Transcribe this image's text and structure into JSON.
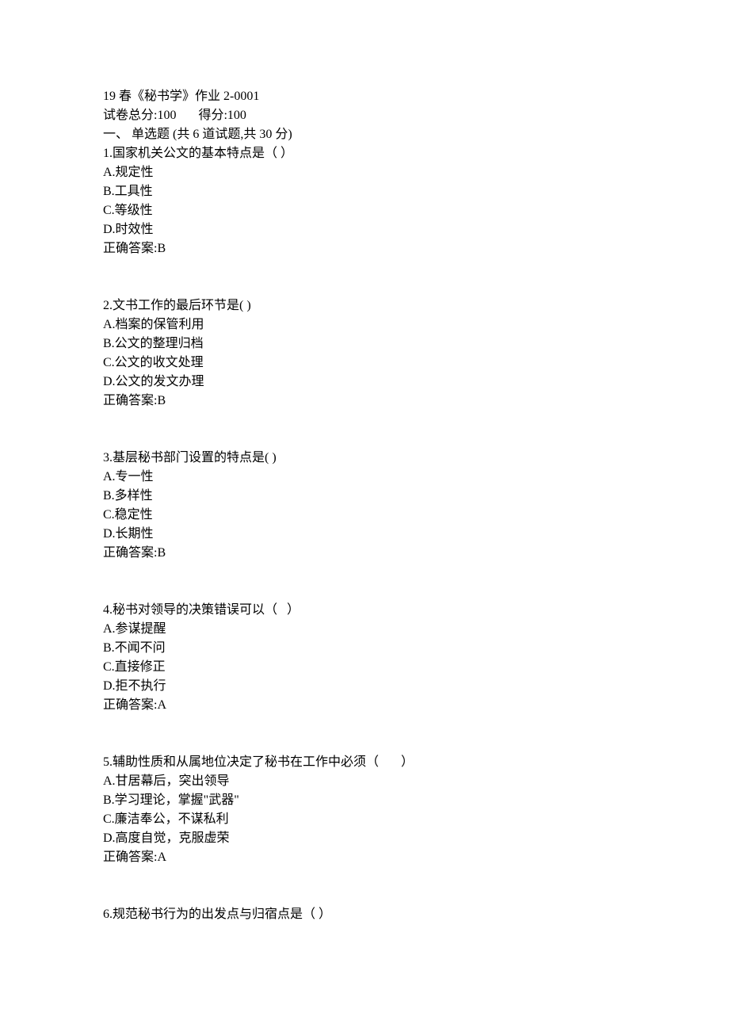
{
  "header": {
    "title": "19 春《秘书学》作业 2-0001",
    "total_score_label": "试卷总分:100",
    "earned_score_label": "得分:100",
    "section_header": "一、 单选题 (共 6 道试题,共 30 分)"
  },
  "questions": [
    {
      "stem": "1.国家机关公文的基本特点是（ ）",
      "options": [
        "A.规定性",
        "B.工具性",
        "C.等级性",
        "D.时效性"
      ],
      "answer": "正确答案:B"
    },
    {
      "stem": "2.文书工作的最后环节是( )",
      "options": [
        "A.档案的保管利用",
        "B.公文的整理归档",
        "C.公文的收文处理",
        "D.公文的发文办理"
      ],
      "answer": "正确答案:B"
    },
    {
      "stem": "3.基层秘书部门设置的特点是( )",
      "options": [
        "A.专一性",
        "B.多样性",
        "C.稳定性",
        "D.长期性"
      ],
      "answer": "正确答案:B"
    },
    {
      "stem": "4.秘书对领导的决策错误可以（   ）",
      "options": [
        "A.参谋提醒",
        "B.不闻不问",
        "C.直接修正",
        "D.拒不执行"
      ],
      "answer": "正确答案:A"
    },
    {
      "stem": "5.辅助性质和从属地位决定了秘书在工作中必须（       ）",
      "options": [
        "A.甘居幕后，突出领导",
        "B.学习理论，掌握\"武器\"",
        "C.廉洁奉公，不谋私利",
        "D.高度自觉，克服虚荣"
      ],
      "answer": "正确答案:A"
    },
    {
      "stem": "6.规范秘书行为的出发点与归宿点是（ ）",
      "options": [],
      "answer": ""
    }
  ]
}
